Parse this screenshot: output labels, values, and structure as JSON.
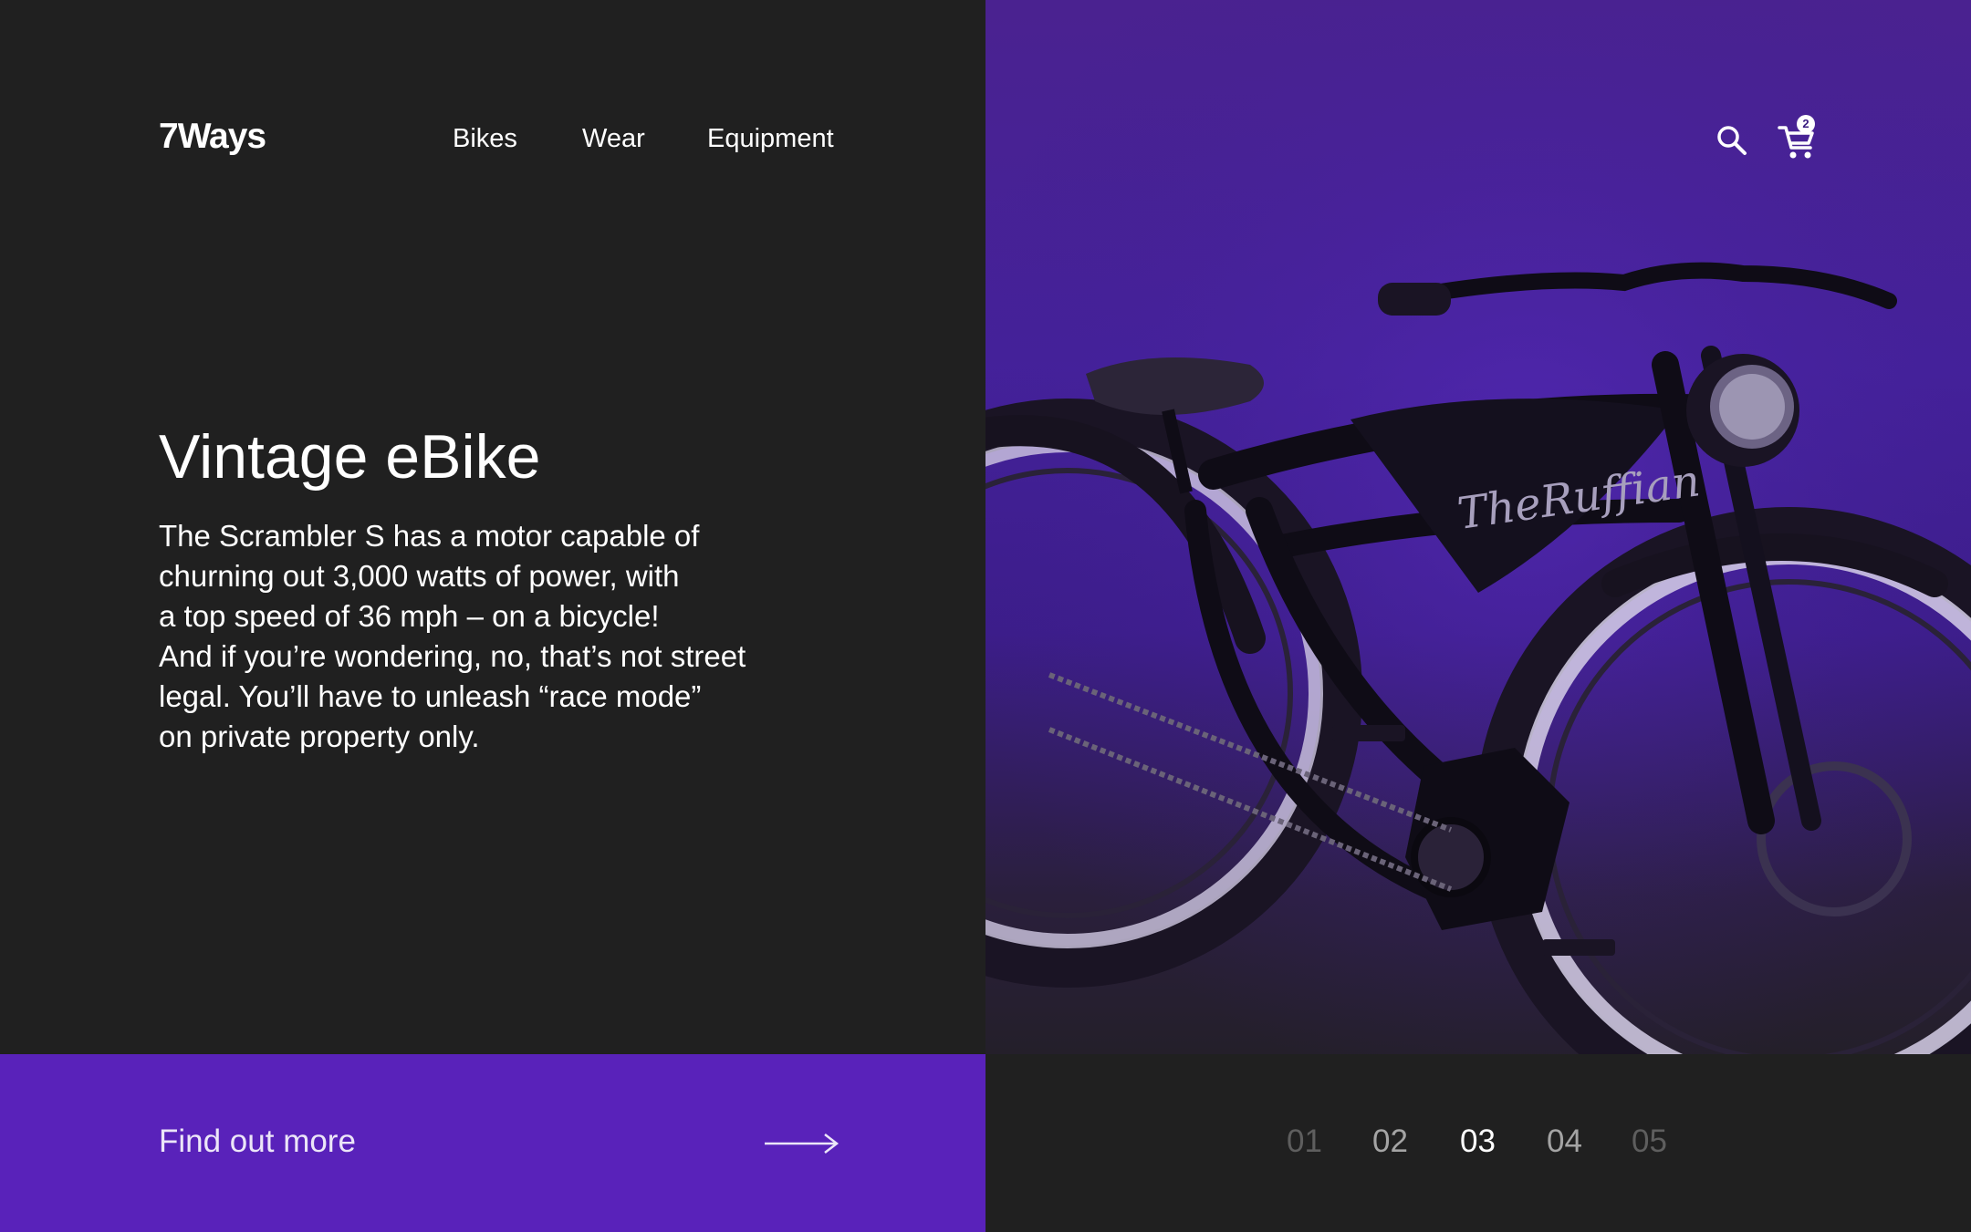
{
  "brand": {
    "logo_text": "7Ways"
  },
  "nav": {
    "items": [
      "Bikes",
      "Wear",
      "Equipment"
    ]
  },
  "hero": {
    "title": "Vintage eBike",
    "description_lines": [
      "The Scrambler S has a motor capable of",
      "churning out 3,000 watts of power, with",
      "a top speed of 36 mph – on a bicycle!",
      "And if you’re wondering, no, that’s not street",
      "legal. You’ll have to unleash “race mode”",
      "on private property only."
    ]
  },
  "header_icons": {
    "search": "search-icon",
    "cart": "cart-icon",
    "cart_count": "2"
  },
  "cta": {
    "label": "Find out more",
    "icon": "arrow-right-icon"
  },
  "product_image": {
    "tank_script": "TheRuffian"
  },
  "pagination": {
    "pages": [
      "01",
      "02",
      "03",
      "04",
      "05"
    ],
    "current": "03"
  },
  "colors": {
    "dark_bg": "#202020",
    "accent_purple": "#5922ba",
    "image_purple": "#44219a",
    "text_white": "#ffffff",
    "muted_gray": "#5e5e5e"
  }
}
